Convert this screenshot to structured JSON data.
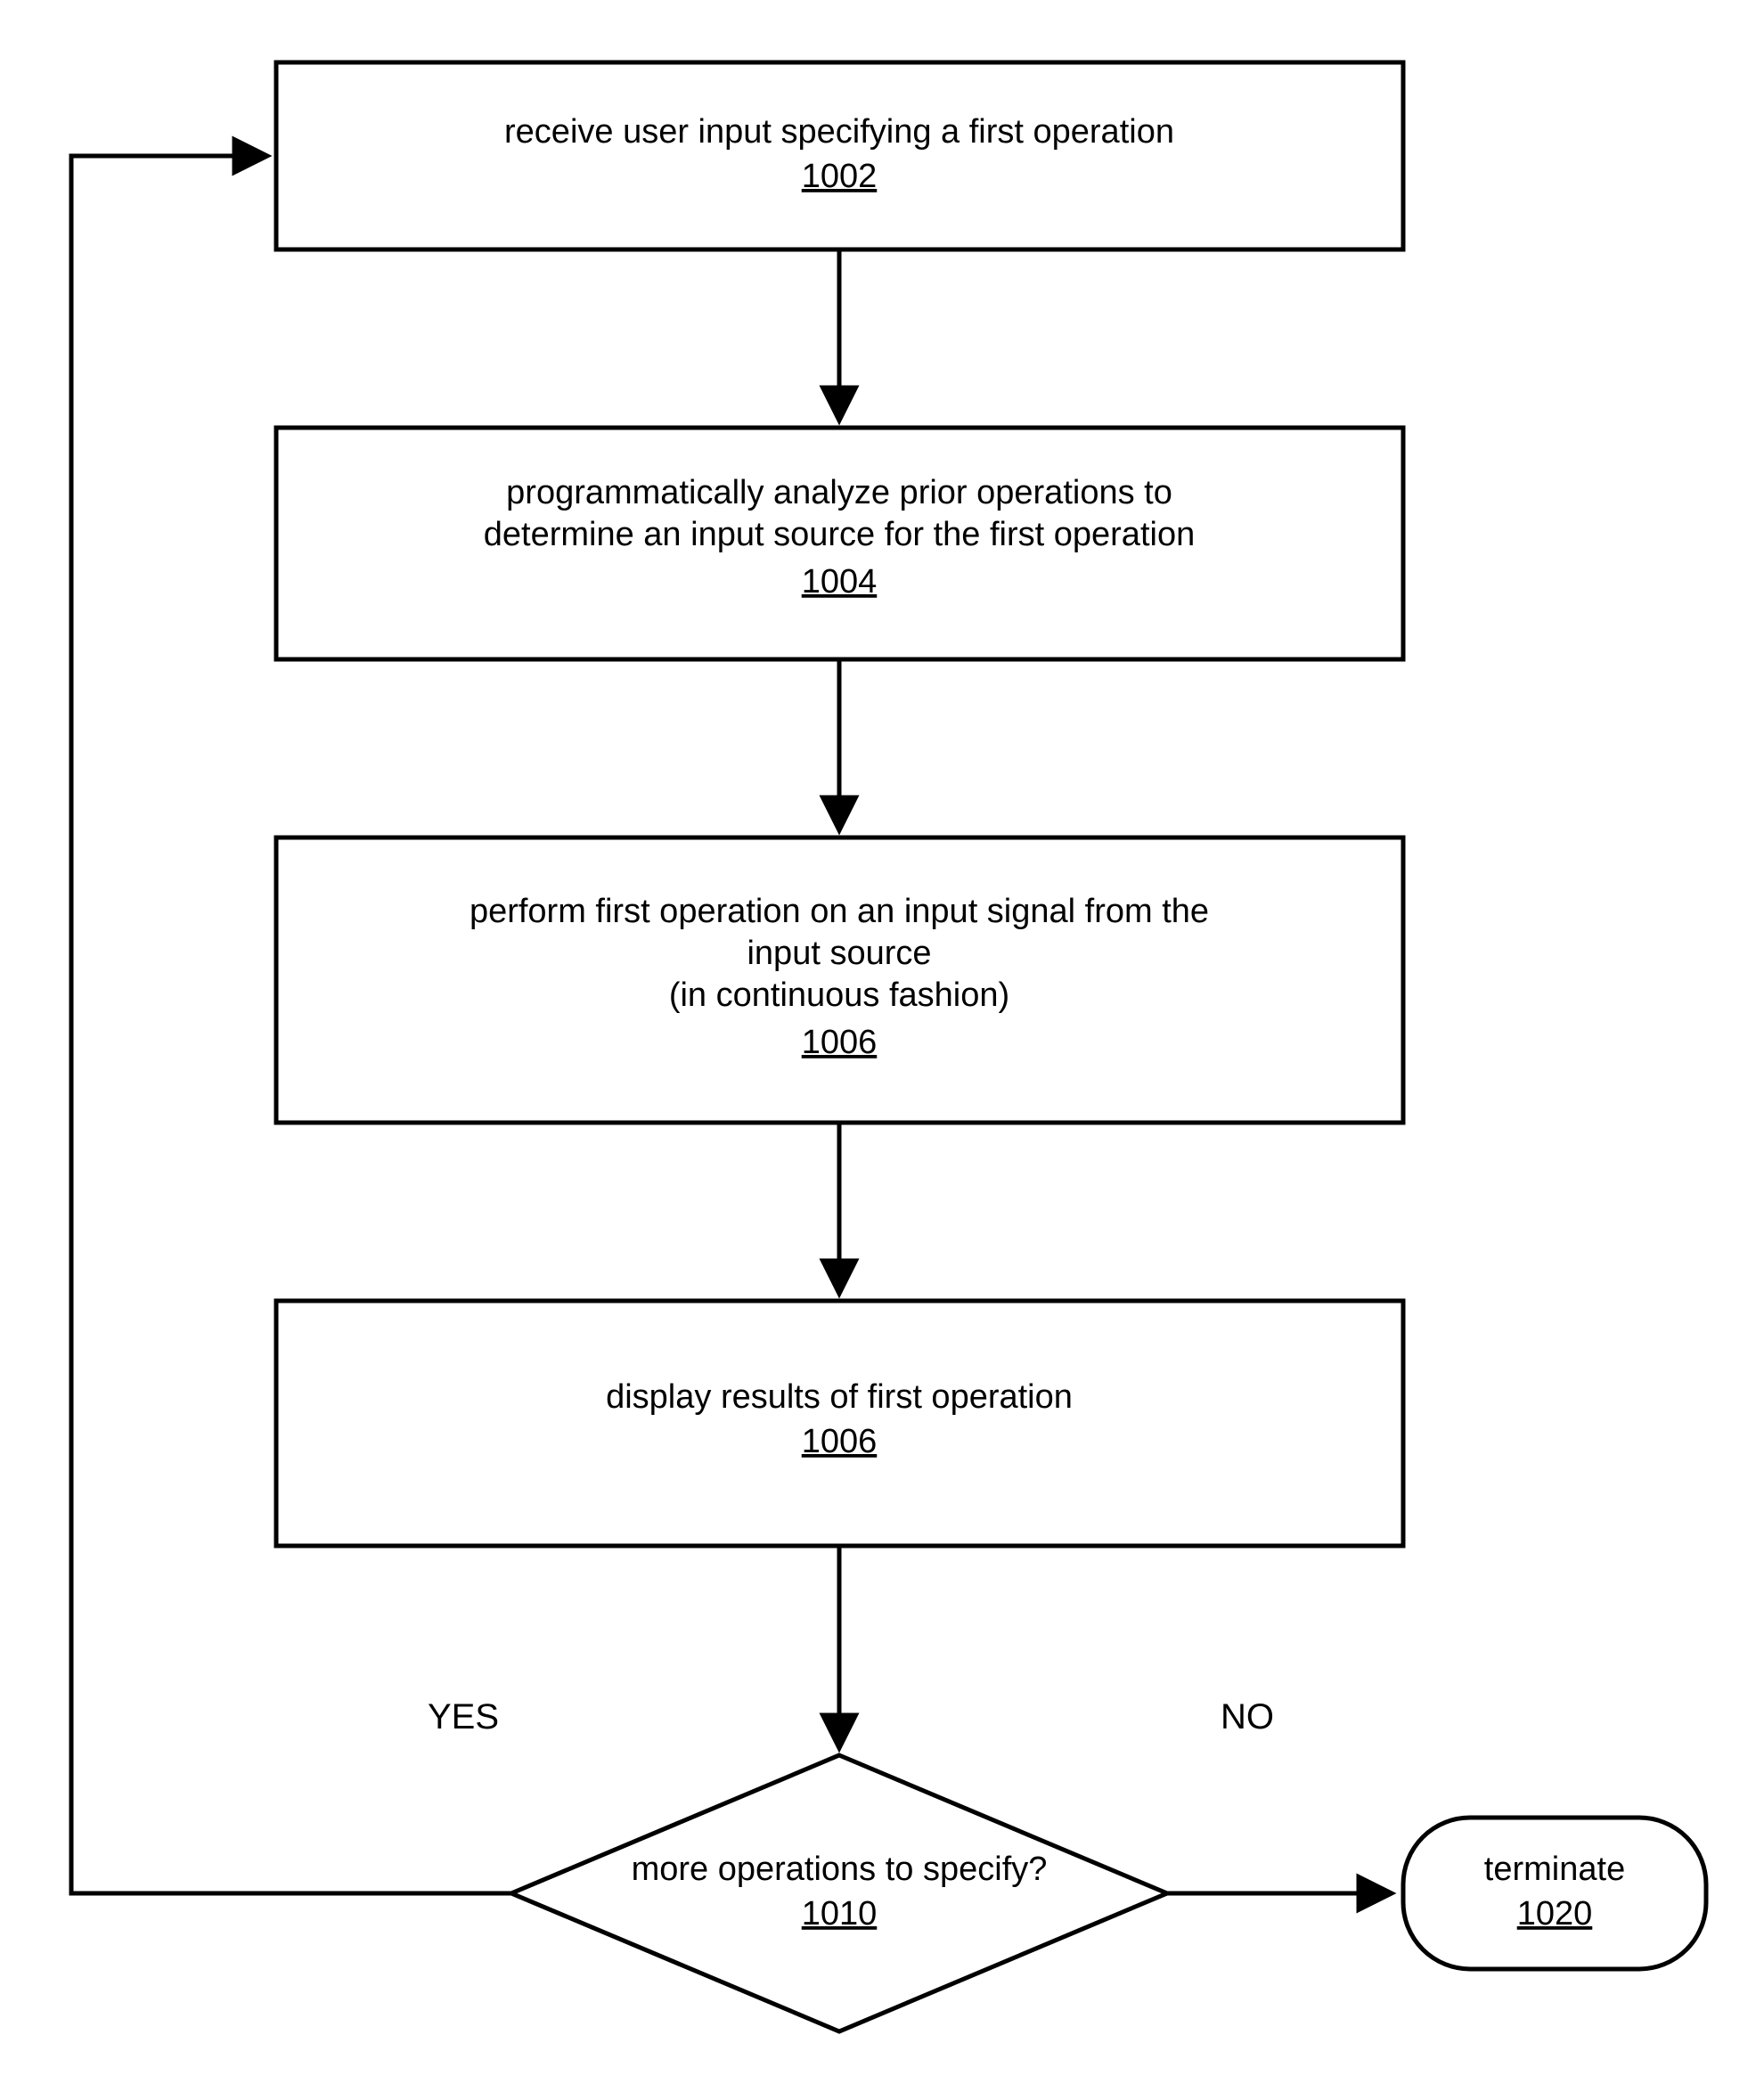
{
  "step1": {
    "text": "receive user input specifying a first operation",
    "ref": "1002"
  },
  "step2": {
    "line1": "programmatically analyze prior operations to",
    "line2": "determine an input source for the first operation",
    "ref": "1004"
  },
  "step3": {
    "line1": "perform first operation on an input signal from the",
    "line2": "input source",
    "line3": "(in continuous fashion)",
    "ref": "1006"
  },
  "step4": {
    "text": "display results of first operation",
    "ref": "1006"
  },
  "decision": {
    "text": "more operations to specify?",
    "ref": "1010",
    "yes": "YES",
    "no": "NO"
  },
  "terminate": {
    "text": "terminate",
    "ref": "1020"
  }
}
